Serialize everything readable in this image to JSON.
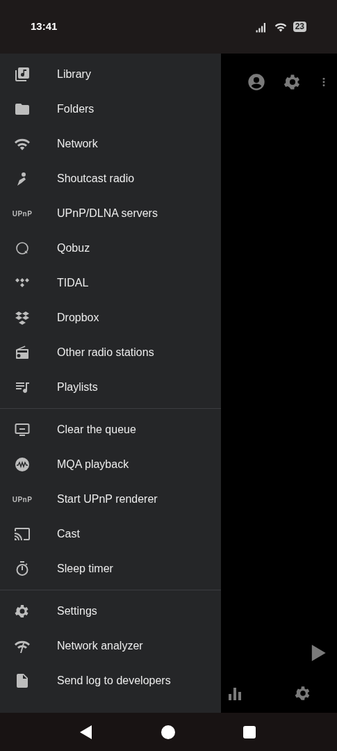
{
  "status_bar": {
    "time": "13:41",
    "battery": "23"
  },
  "drawer": {
    "groups": [
      {
        "items": [
          {
            "label": "Library"
          },
          {
            "label": "Folders"
          },
          {
            "label": "Network"
          },
          {
            "label": "Shoutcast radio"
          },
          {
            "label": "UPnP/DLNA servers",
            "logo_text": "UPnP"
          },
          {
            "label": "Qobuz"
          },
          {
            "label": "TIDAL"
          },
          {
            "label": "Dropbox"
          },
          {
            "label": "Other radio stations"
          },
          {
            "label": "Playlists"
          }
        ]
      },
      {
        "items": [
          {
            "label": "Clear the queue"
          },
          {
            "label": "MQA playback"
          },
          {
            "label": "Start UPnP renderer",
            "logo_text": "UPnP"
          },
          {
            "label": "Cast"
          },
          {
            "label": "Sleep timer"
          }
        ]
      },
      {
        "items": [
          {
            "label": "Settings"
          },
          {
            "label": "Network analyzer"
          },
          {
            "label": "Send log to developers"
          }
        ]
      }
    ]
  }
}
